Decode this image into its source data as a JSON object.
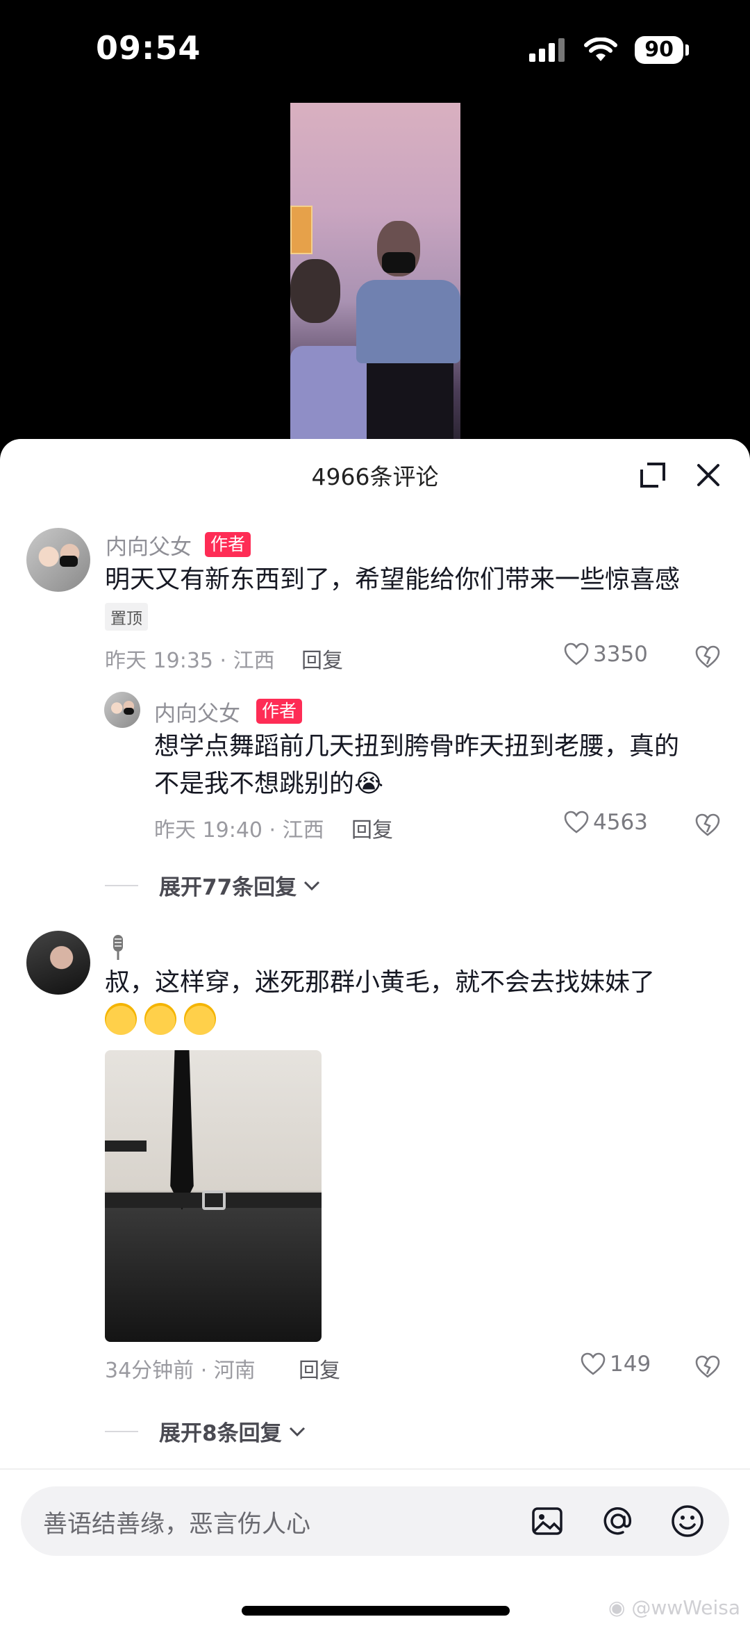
{
  "status_bar": {
    "time": "09:54",
    "battery": "90"
  },
  "sheet": {
    "title": "4966条评论"
  },
  "comments": [
    {
      "author": "内向父女",
      "tag": "作者",
      "text": "明天又有新东西到了，希望能给你们带来一些惊喜感",
      "pin_label": "置顶",
      "meta": "昨天 19:35 · 江西",
      "reply_label": "回复",
      "likes": "3350",
      "replies": [
        {
          "author": "内向父女",
          "tag": "作者",
          "text_line1": "想学点舞蹈前几天扭到胯骨昨天扭到老腰，真的",
          "text_line2": "不是我不想跳别的😭",
          "meta": "昨天 19:40 · 江西",
          "reply_label": "回复",
          "likes": "4563"
        }
      ],
      "expand_label": "展开77条回复"
    },
    {
      "author": "",
      "text": "叔，这样穿，迷死那群小黄毛，就不会去找妹妹了",
      "emoji_count": 3,
      "meta": "34分钟前 · 河南",
      "reply_label": "回复",
      "likes": "149",
      "expand_label": "展开8条回复"
    }
  ],
  "input": {
    "placeholder": "善语结善缘，恶言伤人心"
  },
  "watermark": "@wwWeisa",
  "icons": [
    "signal-icon",
    "wifi-icon",
    "battery-icon",
    "expand-icon",
    "close-icon",
    "heart-icon",
    "dislike-icon",
    "chevron-down-icon",
    "microphone-icon",
    "image-icon",
    "at-icon",
    "emoji-icon",
    "weibo-icon"
  ]
}
